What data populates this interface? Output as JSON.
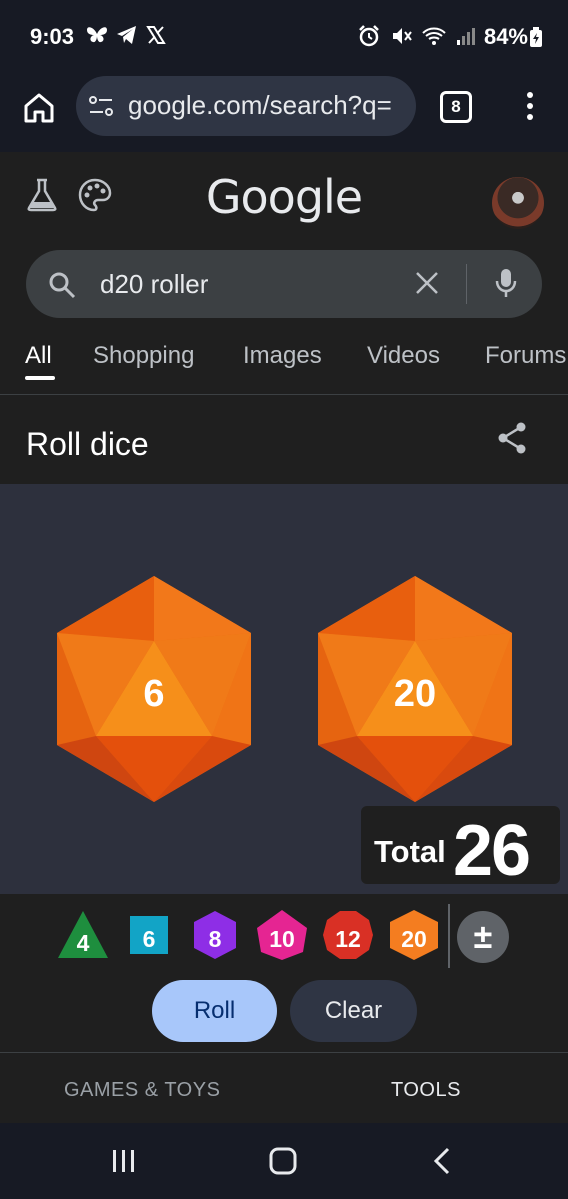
{
  "status_bar": {
    "time": "9:03",
    "battery": "84%",
    "left_icons": [
      "butterfly-icon",
      "telegram-icon",
      "x-icon"
    ],
    "right_icons": [
      "alarm-icon",
      "mute-icon",
      "wifi-icon",
      "signal-icon"
    ]
  },
  "browser": {
    "url": "google.com/search?q=",
    "tab_count": "8"
  },
  "google": {
    "logo": "Google",
    "search_query": "d20 roller"
  },
  "tabs": [
    {
      "label": "All",
      "active": true
    },
    {
      "label": "Shopping"
    },
    {
      "label": "Images"
    },
    {
      "label": "Videos"
    },
    {
      "label": "Forums"
    }
  ],
  "card": {
    "title": "Roll dice"
  },
  "dice": [
    {
      "value": "6",
      "color": "#f47d20"
    },
    {
      "value": "20",
      "color": "#f47d20"
    }
  ],
  "total": {
    "label": "Total",
    "value": "26"
  },
  "dice_buttons": [
    {
      "label": "4",
      "shape": "triangle",
      "color": "#1e8e3e"
    },
    {
      "label": "6",
      "shape": "square",
      "color": "#12a4c6"
    },
    {
      "label": "8",
      "shape": "octagon",
      "color": "#8e2ee6"
    },
    {
      "label": "10",
      "shape": "diamond",
      "color": "#e52592"
    },
    {
      "label": "12",
      "shape": "dodecagon",
      "color": "#d93025"
    },
    {
      "label": "20",
      "shape": "hexagon",
      "color": "#f47d20"
    }
  ],
  "plusminus": "±",
  "actions": {
    "roll": "Roll",
    "clear": "Clear"
  },
  "footer": {
    "games": "GAMES & TOYS",
    "tools": "TOOLS"
  }
}
